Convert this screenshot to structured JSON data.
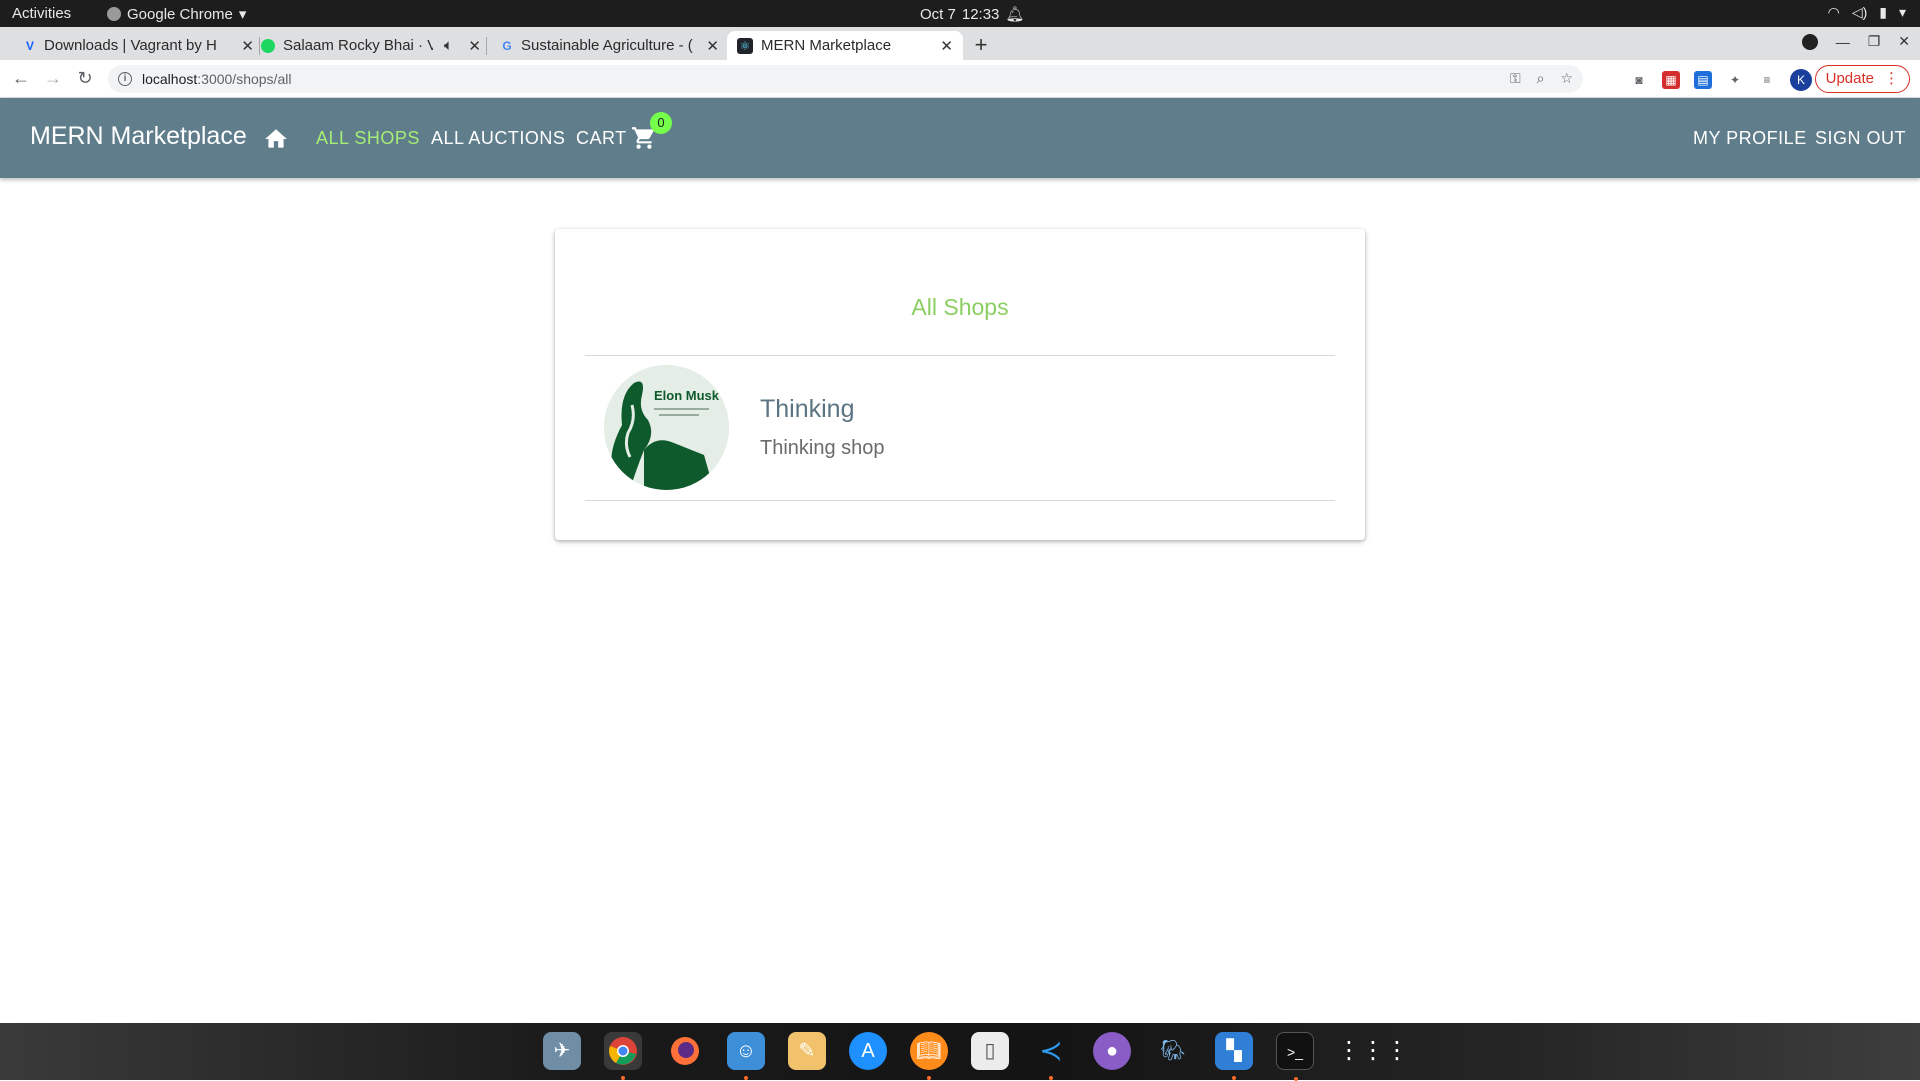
{
  "system_bar": {
    "activities": "Activities",
    "app_name": "Google Chrome",
    "date": "Oct 7",
    "time": "12:33"
  },
  "browser": {
    "tabs": [
      {
        "title": "Downloads | Vagrant by H",
        "favicon": "vagrant-icon",
        "favicon_color": "#1563ff",
        "favicon_text": "V"
      },
      {
        "title": "Salaam Rocky Bhai · Vi",
        "favicon": "spotify-icon",
        "favicon_color": "#1ed760",
        "favicon_text": ""
      },
      {
        "title": "Sustainable Agriculture - (",
        "favicon": "google-icon",
        "favicon_color": "#4285f4",
        "favicon_text": "G"
      },
      {
        "title": "MERN Marketplace",
        "favicon": "react-icon",
        "favicon_color": "#20232a",
        "favicon_text": "⚛"
      }
    ],
    "url_host": "localhost",
    "url_path": ":3000/shops/all",
    "update_label": "Update",
    "profile_initial": "K"
  },
  "app": {
    "brand": "MERN Marketplace",
    "nav": {
      "all_shops": "ALL SHOPS",
      "all_auctions": "ALL AUCTIONS",
      "cart": "CART",
      "cart_count": "0",
      "my_profile": "MY PROFILE",
      "sign_out": "SIGN OUT"
    },
    "colors": {
      "appbar": "#607d8b",
      "active_link": "#a6ed76",
      "title": "#8bcf62"
    }
  },
  "main": {
    "title": "All Shops",
    "shops": [
      {
        "name": "Thinking",
        "description": "Thinking shop",
        "logo_text": "Elon Musk"
      }
    ]
  }
}
